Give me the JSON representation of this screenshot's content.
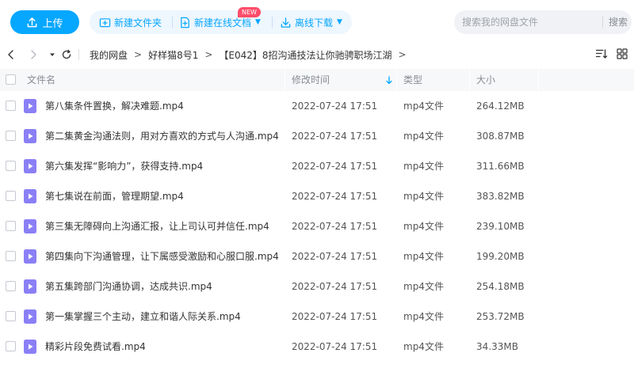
{
  "toolbar": {
    "upload_label": "上传",
    "new_folder_label": "新建文件夹",
    "new_online_doc_label": "新建在线文档",
    "new_badge": "NEW",
    "offline_download_label": "离线下载",
    "search_placeholder": "搜索我的网盘文件",
    "search_button": "搜索"
  },
  "breadcrumb": {
    "items": [
      "我的网盘",
      "好样猫8号1",
      "【E042】8招沟通技法让你驰骋职场江湖"
    ],
    "separator": ">"
  },
  "table": {
    "headers": {
      "name": "文件名",
      "time": "修改时间",
      "type": "类型",
      "size": "大小"
    },
    "sorted_by": "time",
    "sort_direction": "desc",
    "rows": [
      {
        "name": "第八集条件置换，解决难题.mp4",
        "time": "2022-07-24 17:51",
        "type": "mp4文件",
        "size": "264.12MB"
      },
      {
        "name": "第二集黄金沟通法则，用对方喜欢的方式与人沟通.mp4",
        "time": "2022-07-24 17:51",
        "type": "mp4文件",
        "size": "308.87MB"
      },
      {
        "name": "第六集发挥“影响力”，获得支持.mp4",
        "time": "2022-07-24 17:51",
        "type": "mp4文件",
        "size": "311.66MB"
      },
      {
        "name": "第七集说在前面，管理期望.mp4",
        "time": "2022-07-24 17:51",
        "type": "mp4文件",
        "size": "383.82MB"
      },
      {
        "name": "第三集无障碍向上沟通汇报，让上司认可并信任.mp4",
        "time": "2022-07-24 17:51",
        "type": "mp4文件",
        "size": "239.10MB"
      },
      {
        "name": "第四集向下沟通管理，让下属感受激励和心服口服.mp4",
        "time": "2022-07-24 17:51",
        "type": "mp4文件",
        "size": "199.20MB"
      },
      {
        "name": "第五集跨部门沟通协调，达成共识.mp4",
        "time": "2022-07-24 17:51",
        "type": "mp4文件",
        "size": "254.18MB"
      },
      {
        "name": "第一集掌握三个主动，建立和谐人际关系.mp4",
        "time": "2022-07-24 17:51",
        "type": "mp4文件",
        "size": "253.72MB"
      },
      {
        "name": "精彩片段免费试看.mp4",
        "time": "2022-07-24 17:51",
        "type": "mp4文件",
        "size": "34.33MB"
      }
    ]
  },
  "colors": {
    "accent": "#06a7ff",
    "action_bg": "#eef6fe",
    "badge": "#ff4d6a",
    "video_icon": "#8b7ff6"
  },
  "icons": {
    "upload": "upload-arrow-icon",
    "new_folder": "folder-plus-icon",
    "new_doc": "doc-plus-icon",
    "offline": "download-icon",
    "file": "video-file-icon"
  }
}
